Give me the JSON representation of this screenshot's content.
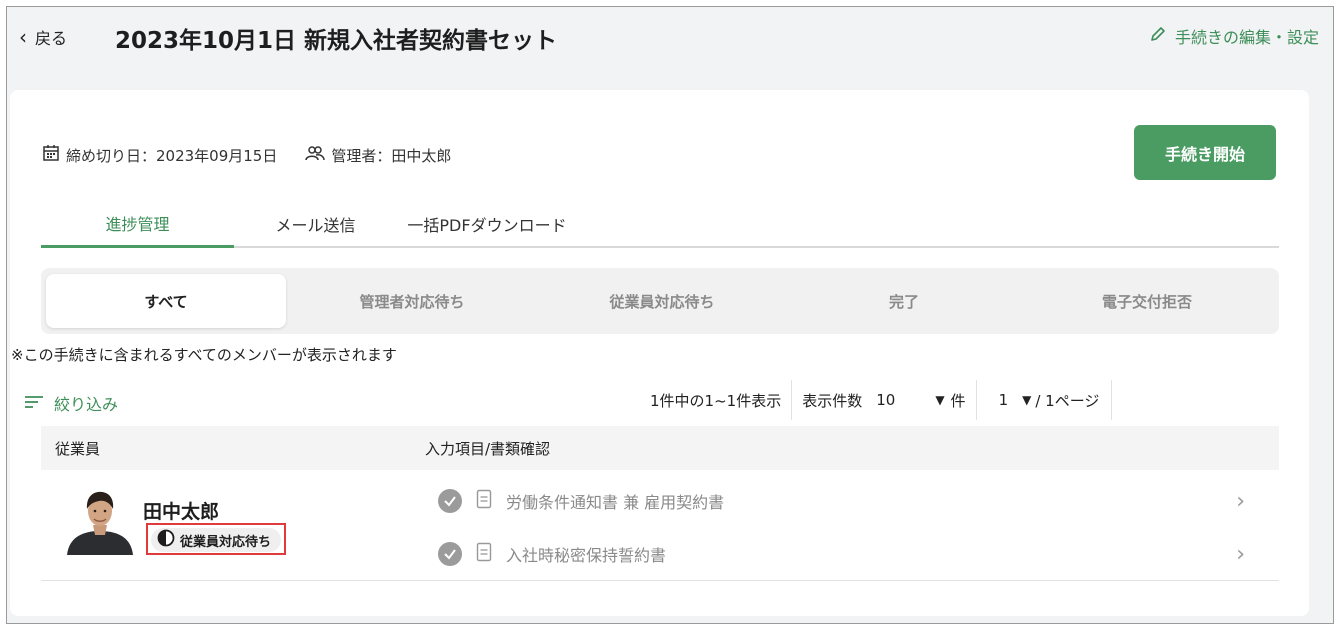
{
  "header": {
    "back_label": "戻る",
    "title": "2023年10月1日 新規入社者契約書セット",
    "edit_label": "手続きの編集・設定"
  },
  "meta": {
    "deadline": "締め切り日：2023年09月15日",
    "manager": "管理者：田中太郎"
  },
  "start_button": "手続き開始",
  "tabs": [
    {
      "label": "進捗管理",
      "active": true
    },
    {
      "label": "メール送信",
      "active": false
    },
    {
      "label": "一括PDFダウンロード",
      "active": false
    }
  ],
  "status_filters": [
    {
      "label": "すべて",
      "active": true
    },
    {
      "label": "管理者対応待ち",
      "active": false
    },
    {
      "label": "従業員対応待ち",
      "active": false
    },
    {
      "label": "完了",
      "active": false
    },
    {
      "label": "電子交付拒否",
      "active": false
    }
  ],
  "note": "※この手続きに含まれるすべてのメンバーが表示されます",
  "filter_label": "絞り込み",
  "pager": {
    "summary": "1件中の1~1件表示",
    "per_page_label": "表示件数",
    "per_page_value": "10",
    "per_page_unit": "件",
    "page_value": "1",
    "page_total": "/ 1ページ"
  },
  "table": {
    "columns": [
      "従業員",
      "入力項目/書類確認"
    ],
    "rows": [
      {
        "employee": "田中太郎",
        "status": "従業員対応待ち",
        "documents": [
          "労働条件通知書 兼 雇用契約書",
          "入社時秘密保持誓約書"
        ]
      }
    ]
  },
  "colors": {
    "accent": "#4a9c63",
    "highlight_box": "#e03a3a"
  }
}
